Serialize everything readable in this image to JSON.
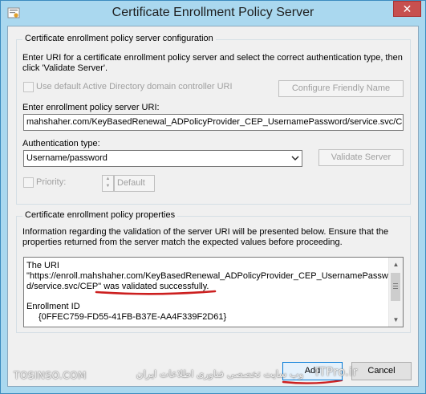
{
  "window": {
    "title": "Certificate Enrollment Policy Server"
  },
  "config": {
    "group_title": "Certificate enrollment policy server configuration",
    "instructions_line1": "Enter URI for a certificate enrollment policy server and select the correct authentication type, then",
    "instructions_line2": "click 'Validate Server'.",
    "default_ad_label": "Use default Active Directory domain controller URI",
    "configure_friendly_name_label": "Configure Friendly Name",
    "uri_label": "Enter enrollment policy server URI:",
    "uri_value": "mahshaher.com/KeyBasedRenewal_ADPolicyProvider_CEP_UsernamePassword/service.svc/CEP",
    "auth_label": "Authentication type:",
    "auth_value": "Username/password",
    "validate_label": "Validate Server",
    "priority_label": "Priority:",
    "default_label": "Default"
  },
  "properties": {
    "group_title": "Certificate enrollment policy properties",
    "info_line1": "Information regarding the validation of the server URI will be presented below. Ensure that the",
    "info_line2": "properties returned from the server match the expected values before proceeding.",
    "result_line1": "The URI",
    "result_line2": "\"https://enroll.mahshaher.com/KeyBasedRenewal_ADPolicyProvider_CEP_UsernamePasswor",
    "result_line3": "d/service.svc/CEP\" was validated successfully.",
    "enrollment_id_label": "Enrollment ID",
    "enrollment_id_value": "{0FFEC759-FD55-41FB-B37E-AA4F339F2D61}"
  },
  "buttons": {
    "add": "Add",
    "cancel": "Cancel"
  },
  "watermark": {
    "left": "TOSINSO.COM",
    "middle": "وب سایت تخصصی فناوری اطلاعات ایران",
    "right": "ITPro.ir"
  },
  "colors": {
    "title_bar": "#aad8ef",
    "close_button": "#c7504f",
    "annotation_red": "#cc1f1f"
  }
}
